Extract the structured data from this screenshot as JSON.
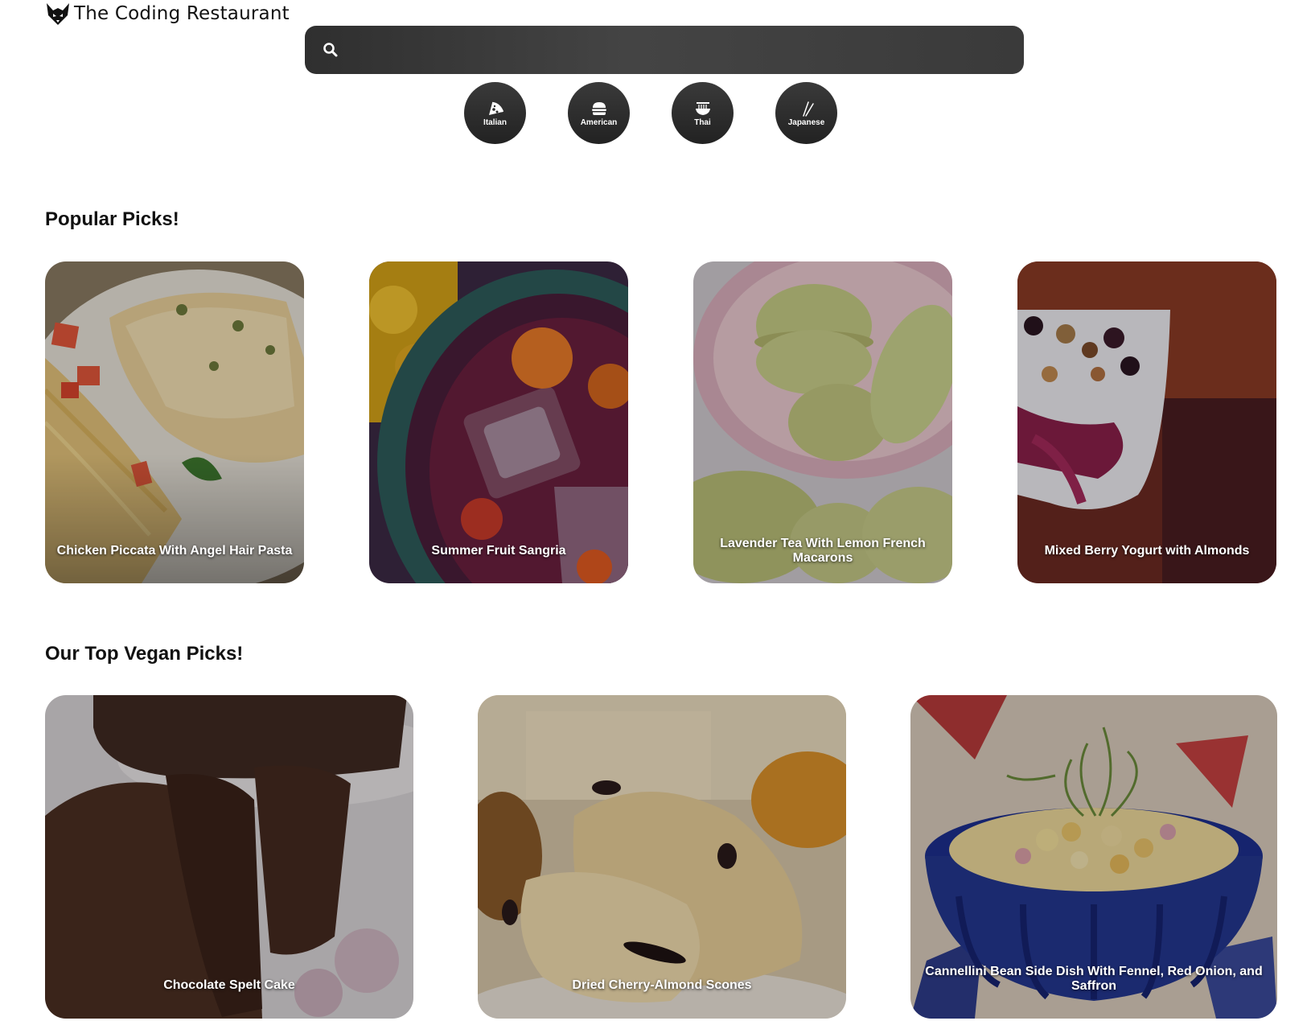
{
  "header": {
    "logo_text": "The Coding Restaurant",
    "logo_icon": "fox-icon"
  },
  "search": {
    "placeholder": "",
    "value": "",
    "icon": "search-icon"
  },
  "cuisines": [
    {
      "label": "Italian",
      "icon": "pizza-icon"
    },
    {
      "label": "American",
      "icon": "burger-icon"
    },
    {
      "label": "Thai",
      "icon": "noodle-bowl-icon"
    },
    {
      "label": "Japanese",
      "icon": "chopsticks-icon"
    }
  ],
  "popular": {
    "title": "Popular Picks!",
    "cards": [
      {
        "label": "Chicken Piccata With Angel Hair Pasta"
      },
      {
        "label": "Summer Fruit Sangria"
      },
      {
        "label": "Lavender Tea With Lemon French Macarons"
      },
      {
        "label": "Mixed Berry Yogurt with Almonds"
      }
    ]
  },
  "vegan": {
    "title": "Our Top Vegan Picks!",
    "cards": [
      {
        "label": "Chocolate Spelt Cake"
      },
      {
        "label": "Dried Cherry-Almond Scones"
      },
      {
        "label": "Cannellini Bean Side Dish With Fennel, Red Onion, and Saffron"
      }
    ]
  }
}
